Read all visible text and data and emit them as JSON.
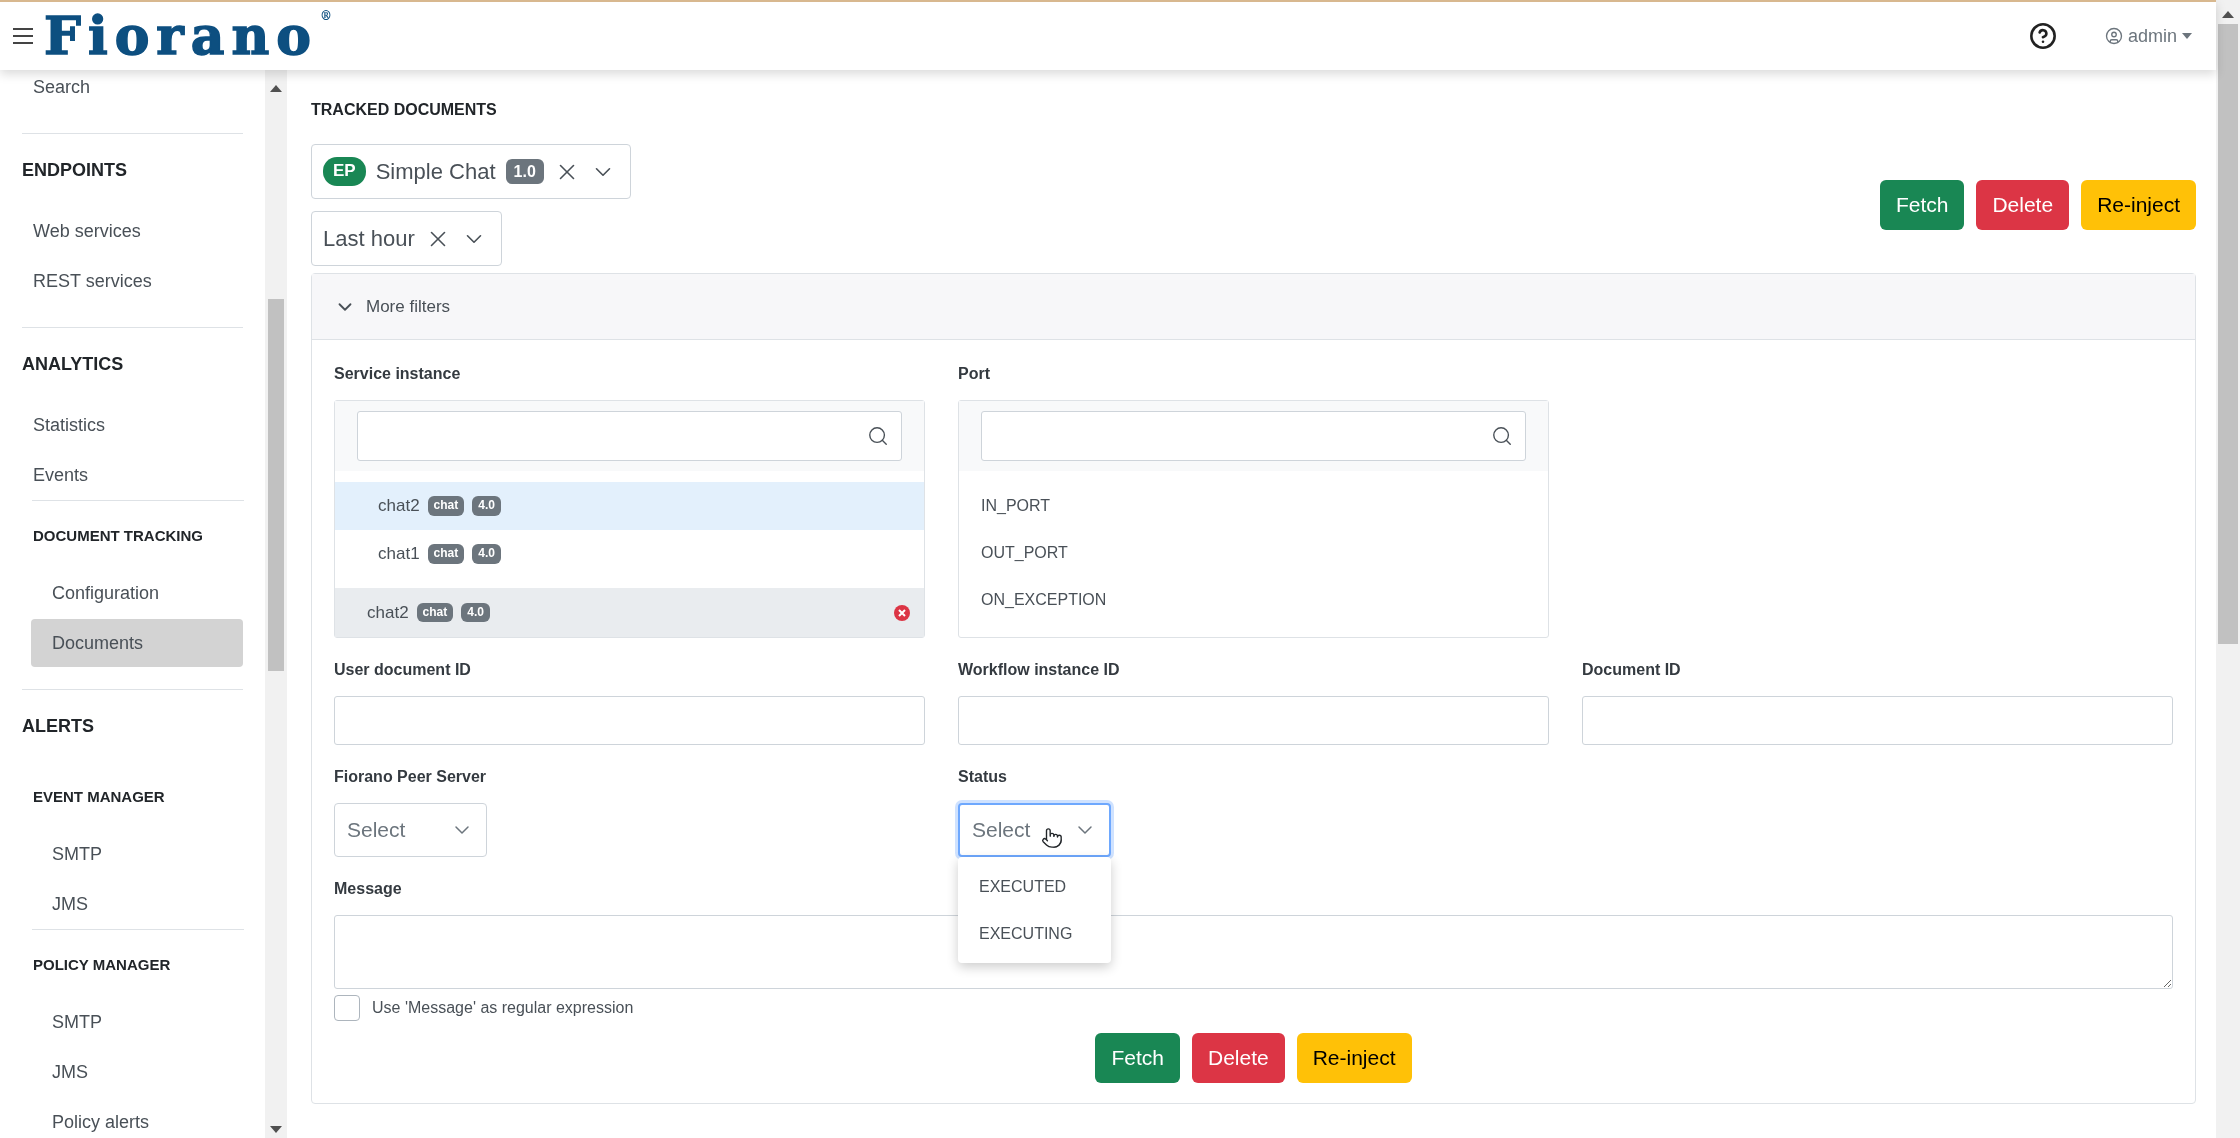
{
  "header": {
    "logo": "Fiorano",
    "logo_mark": "®",
    "user": "admin"
  },
  "sidebar": {
    "sections": [
      {
        "items": [
          {
            "label": "Search",
            "selected": false
          }
        ]
      },
      {
        "title": "ENDPOINTS",
        "items": [
          {
            "label": "Web services",
            "selected": false
          },
          {
            "label": "REST services",
            "selected": false
          }
        ]
      },
      {
        "title": "ANALYTICS",
        "items": [
          {
            "label": "Statistics",
            "selected": false
          },
          {
            "label": "Events",
            "selected": false
          }
        ],
        "groups": [
          {
            "title": "DOCUMENT TRACKING",
            "items": [
              {
                "label": "Configuration",
                "selected": false
              },
              {
                "label": "Documents",
                "selected": true
              }
            ]
          }
        ]
      },
      {
        "title": "ALERTS",
        "groups": [
          {
            "title": "EVENT MANAGER",
            "items": [
              {
                "label": "SMTP",
                "selected": false
              },
              {
                "label": "JMS",
                "selected": false
              }
            ]
          },
          {
            "title": "POLICY MANAGER",
            "items": [
              {
                "label": "SMTP",
                "selected": false
              },
              {
                "label": "JMS",
                "selected": false
              },
              {
                "label": "Policy alerts",
                "selected": false
              }
            ]
          }
        ]
      }
    ]
  },
  "main": {
    "title": "TRACKED DOCUMENTS",
    "filters": [
      {
        "kind": "application",
        "badge": "EP",
        "label": "Simple Chat",
        "version": "1.0"
      },
      {
        "kind": "time",
        "label": "Last hour"
      }
    ],
    "actions": [
      {
        "label": "Fetch",
        "kind": "success"
      },
      {
        "label": "Delete",
        "kind": "danger"
      },
      {
        "label": "Re-inject",
        "kind": "warning"
      }
    ],
    "more_filters": {
      "label": "More filters",
      "expanded": true,
      "service_instance": {
        "label": "Service instance",
        "options": [
          {
            "name": "chat2",
            "tag": "chat",
            "version": "4.0",
            "hovered": true
          },
          {
            "name": "chat1",
            "tag": "chat",
            "version": "4.0",
            "hovered": false
          }
        ],
        "chosen": [
          {
            "name": "chat2",
            "tag": "chat",
            "version": "4.0"
          }
        ]
      },
      "port": {
        "label": "Port",
        "options": [
          "IN_PORT",
          "OUT_PORT",
          "ON_EXCEPTION"
        ]
      },
      "text_fields": [
        {
          "label": "User document ID"
        },
        {
          "label": "Workflow instance ID"
        },
        {
          "label": "Document ID"
        }
      ],
      "peer_server": {
        "label": "Fiorano Peer Server",
        "placeholder": "Select",
        "focused": false
      },
      "status": {
        "label": "Status",
        "placeholder": "Select",
        "focused": true,
        "open": true,
        "options": [
          "EXECUTED",
          "EXECUTING"
        ]
      },
      "message": {
        "label": "Message"
      },
      "regex": {
        "label": "Use 'Message' as regular expression",
        "checked": false
      },
      "actions": [
        {
          "label": "Fetch",
          "kind": "success"
        },
        {
          "label": "Delete",
          "kind": "danger"
        },
        {
          "label": "Re-inject",
          "kind": "warning"
        }
      ]
    }
  }
}
